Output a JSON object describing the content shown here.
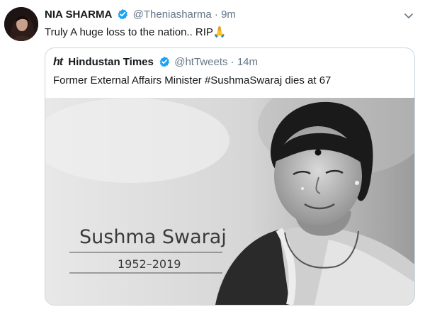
{
  "tweet": {
    "author_name": "NIA SHARMA",
    "handle": "@Theniasharma",
    "separator": "·",
    "time": "9m",
    "text": "Truly A huge loss to the nation.. RIP🙏",
    "icons": {
      "verified": "verified-badge-icon",
      "menu": "chevron-down-icon"
    }
  },
  "quoted": {
    "logo": "ht",
    "author_name": "Hindustan Times",
    "handle": "@htTweets",
    "separator": "·",
    "time": "14m",
    "text": "Former External Affairs Minister #SushmaSwaraj dies at 67",
    "media": {
      "name": "Sushma Swaraj",
      "years": "1952–2019"
    }
  },
  "actions": [
    {
      "icon": "reply-icon"
    },
    {
      "icon": "retweet-icon"
    },
    {
      "icon": "like-icon"
    },
    {
      "icon": "share-icon"
    }
  ],
  "colors": {
    "verified_blue": "#1da1f2",
    "muted_text": "#657786",
    "border": "#ccd6dd"
  }
}
